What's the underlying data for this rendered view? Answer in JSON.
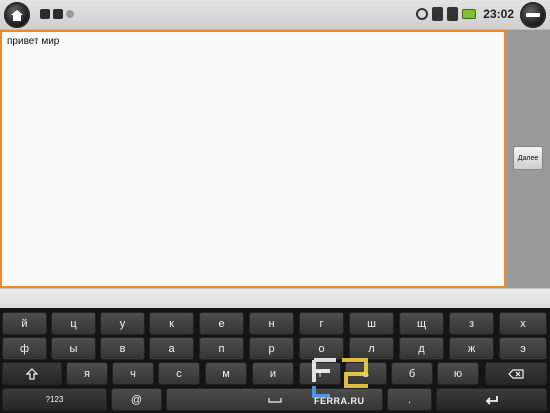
{
  "statusbar": {
    "time": "23:02"
  },
  "editor": {
    "text": "привет мир"
  },
  "action": {
    "next_label": "Далее"
  },
  "keyboard": {
    "row1": [
      "й",
      "ц",
      "у",
      "к",
      "е",
      "н",
      "г",
      "ш",
      "щ",
      "з",
      "х"
    ],
    "row2": [
      "ф",
      "ы",
      "в",
      "а",
      "п",
      "р",
      "о",
      "л",
      "д",
      "ж",
      "э"
    ],
    "row3": [
      "я",
      "ч",
      "с",
      "м",
      "и",
      "т",
      "ь",
      "б",
      "ю"
    ],
    "symbols_label": "?123",
    "at_label": "@",
    "dot_label": ".",
    "shift_icon": "shift-icon",
    "delete_icon": "backspace-icon",
    "enter_icon": "enter-icon",
    "space_icon": "space-icon"
  },
  "watermark": {
    "text": "FERRA.RU"
  }
}
